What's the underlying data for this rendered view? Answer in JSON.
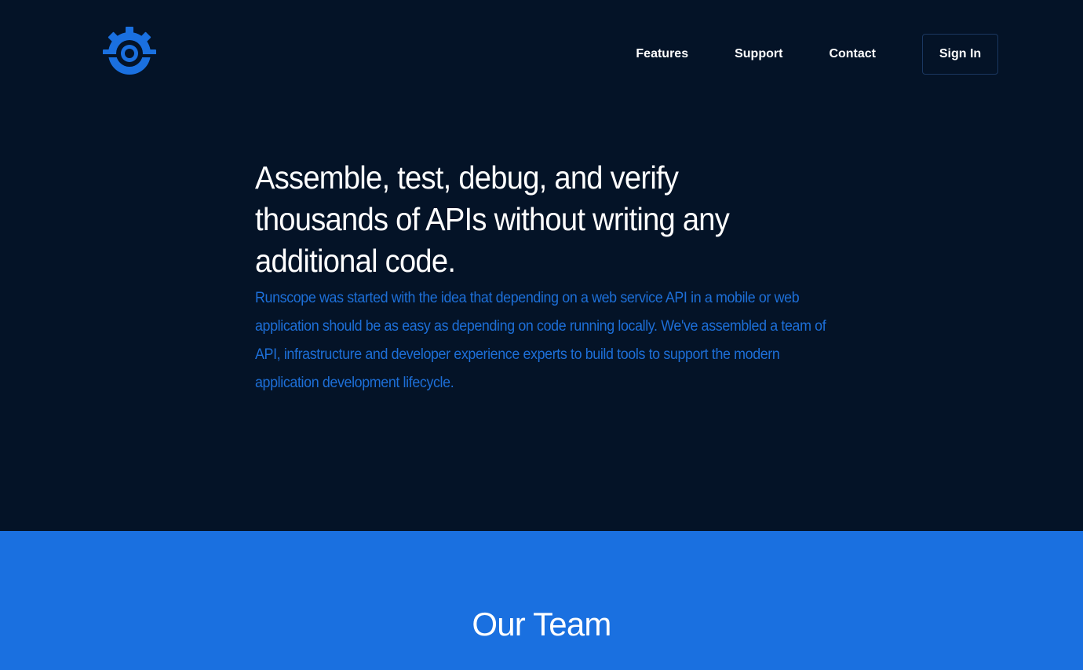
{
  "brand": {
    "logo_icon": "gear-ring-icon",
    "accent_color": "#1a70e0"
  },
  "nav": {
    "items": [
      {
        "label": "Features"
      },
      {
        "label": "Support"
      },
      {
        "label": "Contact"
      }
    ],
    "signin_label": "Sign In"
  },
  "hero": {
    "headline": "Assemble, test, debug, and verify thousands of APIs without writing any additional code.",
    "intro": "Runscope was started with the idea that depending on a web service API in a mobile or web application should be as easy as depending on code running locally. We've assembled a team of API, infrastructure and developer experience experts to build tools to support the modern application development lifecycle."
  },
  "team_section": {
    "title": "Our Team"
  }
}
